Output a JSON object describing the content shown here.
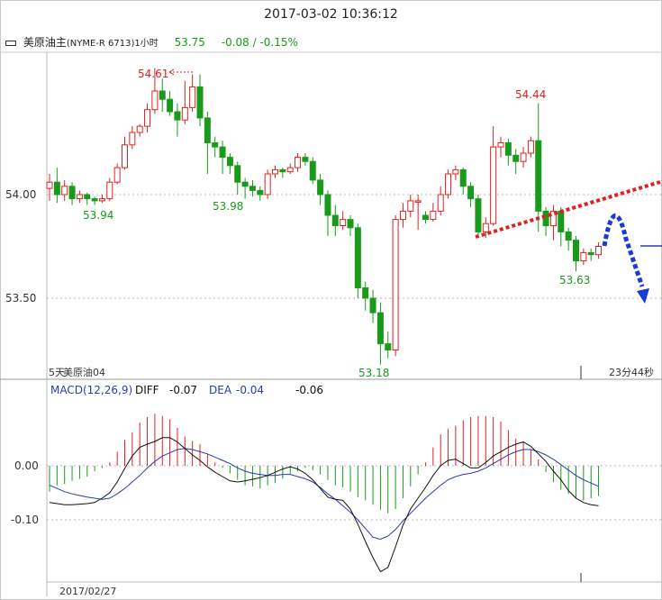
{
  "window": {
    "datetime": "2017-03-02 10:36:12"
  },
  "header": {
    "symbol": "美原油主",
    "code": "(NYME-R 6713)1小时",
    "last": "53.75",
    "change": "-0.08 / -0.15%"
  },
  "colors": {
    "up": "#e02020",
    "down": "#1a9a1a",
    "diff": "#111111",
    "dea": "#2a3cb0",
    "grid": "#bbbbbb"
  },
  "chart_data": [
    {
      "type": "candlestick",
      "yticks": [
        "54.00",
        "53.50"
      ],
      "ylim": [
        52.98,
        54.72
      ],
      "annotations": {
        "high1": "54.61",
        "high2": "54.44",
        "low1": "53.94",
        "low2": "53.98",
        "low3": "53.18",
        "low4": "53.63"
      },
      "footer_left": "5天",
      "footer_label": "美原油04",
      "footer_right": "23分44秒",
      "candles": [
        [
          54.03,
          54.06,
          53.97,
          54.1
        ],
        [
          54.06,
          54.0,
          53.96,
          54.13
        ],
        [
          54.0,
          54.04,
          53.97,
          54.07
        ],
        [
          54.04,
          53.98,
          53.95,
          54.06
        ],
        [
          53.98,
          54.0,
          53.96,
          54.02
        ],
        [
          54.0,
          53.98,
          53.95,
          54.01
        ],
        [
          53.98,
          53.97,
          53.95,
          53.99
        ],
        [
          53.97,
          53.98,
          53.96,
          54.0
        ],
        [
          53.98,
          54.06,
          53.97,
          54.08
        ],
        [
          54.06,
          54.13,
          54.05,
          54.15
        ],
        [
          54.13,
          54.24,
          54.12,
          54.28
        ],
        [
          54.24,
          54.3,
          54.22,
          54.33
        ],
        [
          54.3,
          54.33,
          54.28,
          54.34
        ],
        [
          54.33,
          54.41,
          54.3,
          54.44
        ],
        [
          54.41,
          54.5,
          54.39,
          54.61
        ],
        [
          54.5,
          54.46,
          54.4,
          54.56
        ],
        [
          54.46,
          54.4,
          54.38,
          54.5
        ],
        [
          54.4,
          54.36,
          54.28,
          54.44
        ],
        [
          54.36,
          54.42,
          54.34,
          54.55
        ],
        [
          54.42,
          54.52,
          54.4,
          54.58
        ],
        [
          54.52,
          54.37,
          54.33,
          54.58
        ],
        [
          54.37,
          54.25,
          54.1,
          54.4
        ],
        [
          54.25,
          54.23,
          54.18,
          54.28
        ],
        [
          54.23,
          54.18,
          54.1,
          54.26
        ],
        [
          54.18,
          54.14,
          54.1,
          54.2
        ],
        [
          54.14,
          54.06,
          54.0,
          54.16
        ],
        [
          54.06,
          54.04,
          53.98,
          54.08
        ],
        [
          54.04,
          54.02,
          53.99,
          54.07
        ],
        [
          54.02,
          54.0,
          53.97,
          54.04
        ],
        [
          54.0,
          54.1,
          53.98,
          54.12
        ],
        [
          54.1,
          54.12,
          54.08,
          54.14
        ],
        [
          54.12,
          54.11,
          54.08,
          54.13
        ],
        [
          54.11,
          54.13,
          54.1,
          54.15
        ],
        [
          54.13,
          54.18,
          54.11,
          54.2
        ],
        [
          54.18,
          54.16,
          54.14,
          54.2
        ],
        [
          54.16,
          54.07,
          54.05,
          54.18
        ],
        [
          54.07,
          54.0,
          53.95,
          54.1
        ],
        [
          54.0,
          53.9,
          53.8,
          54.02
        ],
        [
          53.9,
          53.85,
          53.8,
          53.95
        ],
        [
          53.85,
          53.88,
          53.83,
          53.92
        ],
        [
          53.88,
          53.84,
          53.8,
          53.9
        ],
        [
          53.84,
          53.55,
          53.5,
          53.86
        ],
        [
          53.55,
          53.5,
          53.44,
          53.58
        ],
        [
          53.5,
          53.43,
          53.38,
          53.54
        ],
        [
          53.43,
          53.28,
          53.18,
          53.48
        ],
        [
          53.28,
          53.25,
          53.21,
          53.34
        ],
        [
          53.25,
          53.88,
          53.22,
          53.9
        ],
        [
          53.88,
          53.92,
          53.84,
          53.96
        ],
        [
          53.92,
          53.97,
          53.89,
          54.0
        ],
        [
          53.97,
          53.97,
          53.83,
          54.0
        ],
        [
          53.9,
          53.88,
          53.86,
          53.92
        ],
        [
          53.88,
          53.92,
          53.87,
          53.96
        ],
        [
          53.92,
          54.0,
          53.9,
          54.04
        ],
        [
          54.0,
          54.1,
          53.98,
          54.12
        ],
        [
          54.1,
          54.12,
          54.07,
          54.14
        ],
        [
          54.12,
          54.04,
          54.0,
          54.13
        ],
        [
          54.04,
          53.98,
          53.94,
          54.06
        ],
        [
          53.98,
          53.82,
          53.79,
          54.0
        ],
        [
          53.82,
          53.86,
          53.79,
          53.89
        ],
        [
          53.86,
          54.23,
          53.85,
          54.33
        ],
        [
          54.23,
          54.25,
          54.18,
          54.28
        ],
        [
          54.25,
          54.19,
          54.14,
          54.27
        ],
        [
          54.19,
          54.16,
          54.1,
          54.22
        ],
        [
          54.16,
          54.2,
          54.13,
          54.23
        ],
        [
          54.2,
          54.26,
          54.18,
          54.28
        ],
        [
          54.26,
          53.92,
          53.82,
          54.44
        ],
        [
          53.92,
          53.85,
          53.8,
          53.94
        ],
        [
          53.85,
          53.92,
          53.78,
          53.95
        ],
        [
          53.92,
          53.82,
          53.75,
          53.94
        ],
        [
          53.82,
          53.78,
          53.73,
          53.84
        ],
        [
          53.78,
          53.68,
          53.63,
          53.8
        ],
        [
          53.68,
          53.72,
          53.66,
          53.74
        ],
        [
          53.72,
          53.71,
          53.68,
          53.74
        ],
        [
          53.71,
          53.75,
          53.69,
          53.77
        ]
      ]
    },
    {
      "type": "macd",
      "label": "MACD(12,26,9)",
      "diff_label": "DIFF",
      "diff_value": "-0.07",
      "dea_label": "DEA",
      "dea_value": "-0.04",
      "macd_value": "-0.06",
      "yticks": [
        "0.00",
        "-0.10"
      ],
      "ylim": [
        -0.21,
        0.12
      ],
      "date_label": "2017/02/27",
      "hist": [
        -0.048,
        -0.036,
        -0.034,
        -0.028,
        -0.024,
        -0.02,
        -0.01,
        -0.004,
        0.006,
        0.026,
        0.048,
        0.062,
        0.08,
        0.09,
        0.096,
        0.092,
        0.086,
        0.07,
        0.054,
        0.046,
        0.04,
        0.022,
        0.006,
        -0.004,
        -0.014,
        -0.026,
        -0.036,
        -0.038,
        -0.042,
        -0.036,
        -0.032,
        -0.024,
        -0.016,
        -0.01,
        -0.004,
        -0.008,
        -0.016,
        -0.026,
        -0.036,
        -0.04,
        -0.048,
        -0.058,
        -0.064,
        -0.072,
        -0.082,
        -0.088,
        -0.08,
        -0.06,
        -0.038,
        -0.016,
        0.006,
        0.034,
        0.058,
        0.068,
        0.074,
        0.084,
        0.09,
        0.092,
        0.092,
        0.09,
        0.082,
        0.066,
        0.05,
        0.044,
        0.03,
        0.012,
        -0.012,
        -0.03,
        -0.044,
        -0.052,
        -0.06,
        -0.064,
        -0.06,
        -0.056
      ],
      "diff": [
        -0.068,
        -0.07,
        -0.072,
        -0.072,
        -0.071,
        -0.07,
        -0.068,
        -0.06,
        -0.05,
        -0.03,
        -0.005,
        0.018,
        0.034,
        0.04,
        0.045,
        0.052,
        0.052,
        0.044,
        0.032,
        0.02,
        0.01,
        -0.002,
        -0.012,
        -0.02,
        -0.028,
        -0.03,
        -0.028,
        -0.025,
        -0.022,
        -0.018,
        -0.012,
        -0.006,
        -0.002,
        -0.006,
        -0.014,
        -0.026,
        -0.042,
        -0.058,
        -0.062,
        -0.064,
        -0.08,
        -0.108,
        -0.14,
        -0.17,
        -0.196,
        -0.188,
        -0.15,
        -0.11,
        -0.08,
        -0.06,
        -0.04,
        -0.018,
        0.0,
        0.01,
        0.012,
        0.004,
        -0.004,
        -0.004,
        0.006,
        0.018,
        0.026,
        0.034,
        0.04,
        0.044,
        0.036,
        0.022,
        0.008,
        -0.01,
        -0.026,
        -0.046,
        -0.06,
        -0.068,
        -0.072,
        -0.074
      ],
      "dea": [
        -0.036,
        -0.042,
        -0.048,
        -0.052,
        -0.055,
        -0.058,
        -0.06,
        -0.062,
        -0.06,
        -0.052,
        -0.042,
        -0.03,
        -0.018,
        -0.004,
        0.008,
        0.018,
        0.024,
        0.03,
        0.032,
        0.03,
        0.026,
        0.022,
        0.016,
        0.01,
        0.004,
        -0.004,
        -0.01,
        -0.014,
        -0.016,
        -0.018,
        -0.018,
        -0.016,
        -0.016,
        -0.02,
        -0.024,
        -0.03,
        -0.04,
        -0.052,
        -0.062,
        -0.074,
        -0.086,
        -0.1,
        -0.116,
        -0.132,
        -0.136,
        -0.13,
        -0.118,
        -0.102,
        -0.088,
        -0.074,
        -0.06,
        -0.048,
        -0.036,
        -0.026,
        -0.02,
        -0.016,
        -0.014,
        -0.01,
        -0.004,
        0.004,
        0.012,
        0.02,
        0.026,
        0.03,
        0.03,
        0.026,
        0.02,
        0.012,
        0.002,
        -0.008,
        -0.018,
        -0.026,
        -0.032,
        -0.038
      ]
    }
  ]
}
